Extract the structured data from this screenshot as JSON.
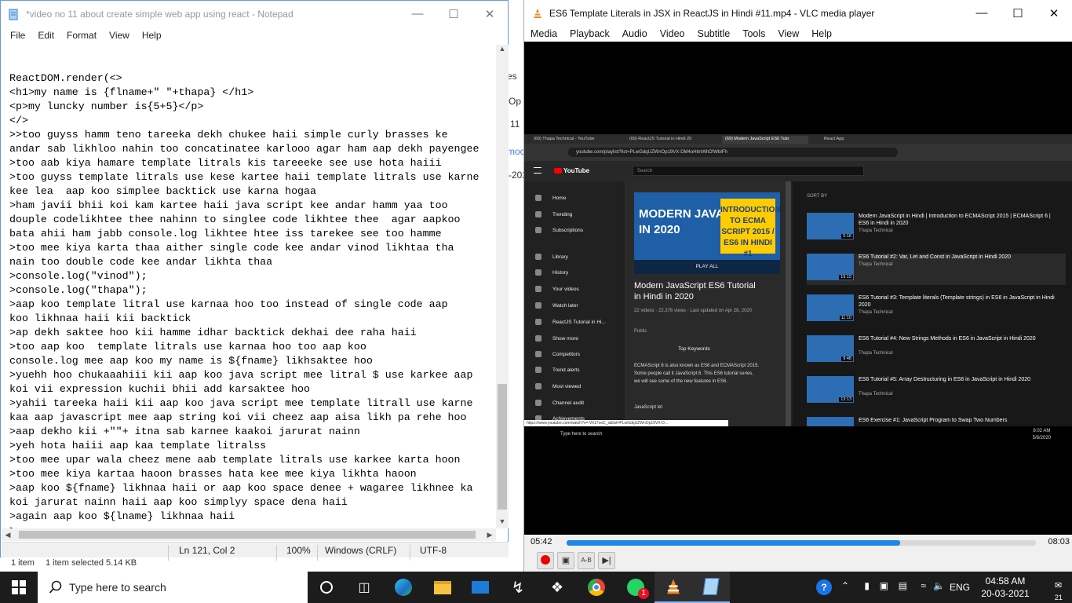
{
  "notepad": {
    "title": "*video no 11 about create simple web app using react - Notepad",
    "menu": [
      "File",
      "Edit",
      "Format",
      "View",
      "Help"
    ],
    "lines": [
      "",
      "ReactDOM.render(<>",
      "<h1>my name is {flname+\" \"+thapa} </h1>",
      "<p>my luncky number is{5+5}</p>",
      "</>",
      ">>too guyss hamm teno tareeka dekh chukee haii simple curly brasses ke",
      "andar sab likhloo nahin too concatinatee karlooo agar ham aap dekh payengee",
      ">too aab kiya hamare template litrals kis tareeeke see use hota haiii",
      ">too guyss template litrals use kese kartee haii template litrals use karne",
      "kee lea  aap koo simplee backtick use karna hogaa",
      ">ham javii bhii koi kam kartee haii java script kee andar hamm yaa too",
      "douple codelikhtee thee nahinn to singlee code likhtee thee  agar aapkoo",
      "bata ahii ham jabb console.log likhtee htee iss tarekee see too hamme",
      ">too mee kiya karta thaa aither single code kee andar vinod likhtaa tha",
      "nain too double code kee andar likhta thaa",
      ">console.log(\"vinod\");",
      ">console.log(\"thapa\");",
      ">aap koo template litral use karnaa hoo too instead of single code aap",
      "koo likhnaa haii kii backtick",
      ">ap dekh saktee hoo kii hamme idhar backtick dekhai dee raha haii",
      ">too aap koo  template litrals use karnaa hoo too aap koo",
      "console.log mee aap koo my name is ${fname} likhsaktee hoo",
      ">yuehh hoo chukaaahiii kii aap koo java script mee litral $ use karkee aap",
      "koi vii expression kuchii bhii add karsaktee hoo",
      ">yahii tareeka haii kii aap koo java script mee template litrall use karne",
      "kaa aap javascript mee aap string koi vii cheez aap aisa likh pa rehe hoo",
      ">aap dekho kii +\"\"+ itna sab karnee kaakoi jarurat nainn",
      ">yeh hota haiii aap kaa template litralss",
      ">too mee upar wala cheez mene aab template litrals use karkee karta hoon",
      ">too mee kiya kartaa haoon brasses hata kee mee kiya likhta haoon",
      ">aap koo ${fname} likhnaa haii or aap koo space denee + wagaree likhnee ka",
      "koi jarurat nainn haii aap koo simplyy space dena haii",
      ">again aap koo ${lname} likhnaa haii",
      ">"
    ],
    "status": {
      "position": "Ln 121, Col 2",
      "zoom": "100%",
      "eol": "Windows (CRLF)",
      "encoding": "UTF-8"
    }
  },
  "explorer": {
    "items": "1 item",
    "selected": "1 item selected  5.14 KB",
    "peek": [
      "es",
      "Op",
      "11",
      "moc",
      "-202"
    ]
  },
  "vlc": {
    "title": "ES6 Template Literals in JSX in ReactJS in Hindi #11.mp4 - VLC media player",
    "menu": [
      "Media",
      "Playback",
      "Audio",
      "Video",
      "Subtitle",
      "Tools",
      "View",
      "Help"
    ],
    "time_elapsed": "05:42",
    "time_total": "08:03",
    "progress": 0.71,
    "video": {
      "tabs": [
        "(69) Thapa Technical - YouTube",
        "(69) ReactJS Tutorial in Hindi 20",
        "(69) Modern JavaScript ES6 Tuto",
        "React App"
      ],
      "url": "youtube.com/playlist?list=PLwGdqUZWnOp19VX-DM4oHtmWhDfWbIFh",
      "search": "Search",
      "sidebar": [
        "Home",
        "Trending",
        "Subscriptions",
        "Library",
        "History",
        "Your videos",
        "Watch later",
        "ReactJS Tutorial in Hi...",
        "Show more",
        "Competitors",
        "Trend alerts",
        "Most viewed",
        "Channel audit",
        "Achievements"
      ],
      "thumb_left": "MODERN JAVASCRIPT IN 2020",
      "thumb_right": "INTRODUCTION TO ECMA SCRIPT 2015 / ES6 IN HINDI #1",
      "play_all": "PLAY ALL",
      "playlist_title": "Modern JavaScript ES6 Tutorial in Hindi in 2020",
      "meta": "22 videos · 22,376 views · Last updated on Apr 28, 2020",
      "visibility": "Public",
      "top_keywords": "Top Keywords",
      "desc": "ECMAScript 6 is also known as ES6 and ECMAScript 2015. Some people call it JavaScript 6. This ES6 tutorial series, we will see some of the new features in ES6.",
      "desc2": "JavaScript let",
      "sort": "SORT BY",
      "channel": "Thapa Technical",
      "items": [
        {
          "title": "Modern JavaScript in Hindi | Introduction to ECMAScript 2015 | ECMAScript 6 | ES6 in Hindi in 2020",
          "dur": "5:16"
        },
        {
          "title": "ES6 Tutorial #2: Var, Let and Const in JavaScript in Hindi 2020",
          "dur": "19:15"
        },
        {
          "title": "ES6 Tutorial #3: Template literals (Template strings) in ES6 in JavaScript in Hindi 2020",
          "dur": "11:10"
        },
        {
          "title": "ES6 Tutorial #4: New Strings Methods in ES6 in JavaScript in Hindi 2020",
          "dur": "9:48"
        },
        {
          "title": "ES6 Tutorial #5: Array Destructuring in ES6 in JavaScript in Hindi 2020",
          "dur": "13:13"
        },
        {
          "title": "ES6 Exercise #1: JavaScript Program to Swap Two Numbers",
          "dur": ""
        }
      ],
      "task_search": "Type here to search",
      "task_time": "8:02 AM",
      "task_date": "5/8/2020",
      "status_url": "https://www.youtube.com/watch?v=-Vh17ooC_s&list=PLwGdqUZWnOp19VX-D..."
    }
  },
  "taskbar": {
    "search": "Type here to search",
    "time": "04:58 AM",
    "date": "20-03-2021",
    "lang": "ENG",
    "notif": "21",
    "whatsapp_badge": "1"
  }
}
